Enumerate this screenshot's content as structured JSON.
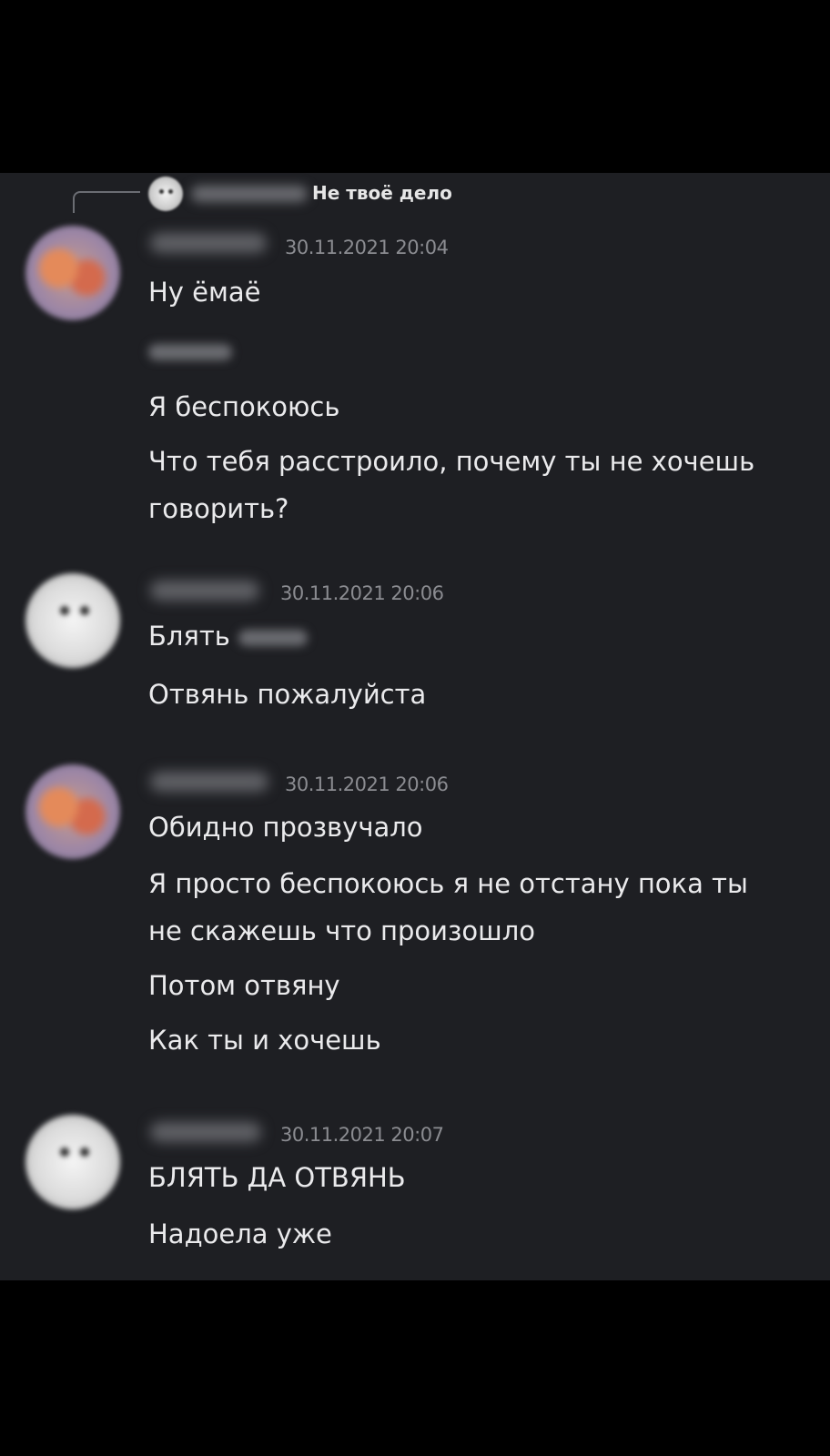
{
  "reply": {
    "text": "Не твоё дело"
  },
  "messages": [
    {
      "timestamp": "30.11.2021 20:04",
      "lines": [
        "Ну ёмаё",
        "",
        "Я беспокоюсь",
        "Что тебя расстроило, почему ты не хочешь",
        "говорить?"
      ]
    },
    {
      "timestamp": "30.11.2021 20:06",
      "lines": [
        "Блять",
        "Отвянь пожалуйста"
      ]
    },
    {
      "timestamp": "30.11.2021 20:06",
      "lines": [
        "Обидно прозвучало",
        "Я просто беспокоюсь я не отстану пока ты",
        "не скажешь что произошло",
        "Потом отвяну",
        "Как ты и хочешь"
      ]
    },
    {
      "timestamp": "30.11.2021 20:07",
      "lines": [
        "БЛЯТЬ ДА ОТВЯНЬ",
        "Надоела уже"
      ]
    }
  ]
}
